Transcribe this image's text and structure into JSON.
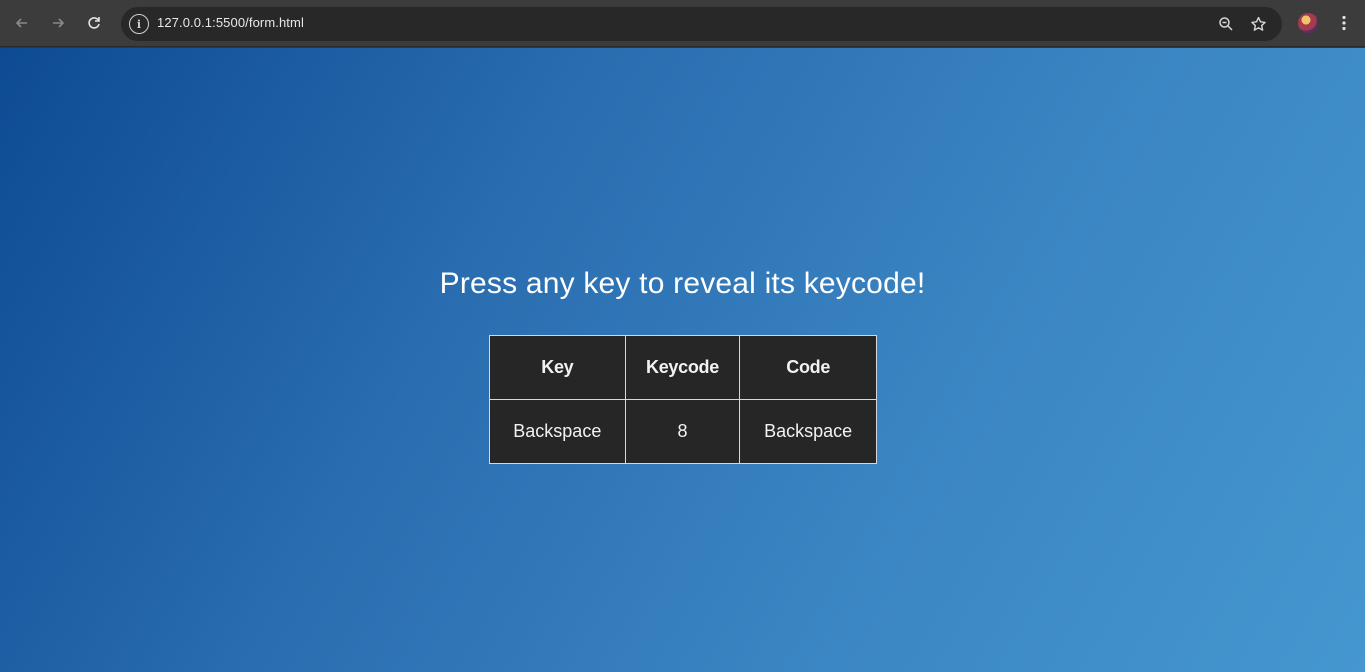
{
  "browser": {
    "url": "127.0.0.1:5500/form.html",
    "back_icon": "arrow-left-icon",
    "forward_icon": "arrow-right-icon",
    "reload_icon": "reload-icon",
    "info_icon": "info-icon",
    "zoom_icon": "zoom-icon",
    "bookmark_icon": "star-icon",
    "menu_icon": "kebab-menu-icon"
  },
  "page": {
    "heading": "Press any key to reveal its keycode!",
    "table": {
      "headers": [
        "Key",
        "Keycode",
        "Code"
      ],
      "row": [
        "Backspace",
        "8",
        "Backspace"
      ]
    }
  },
  "colors": {
    "gradient_start": "#0d4a93",
    "gradient_end": "#4597d0",
    "table_bg": "#262626"
  }
}
